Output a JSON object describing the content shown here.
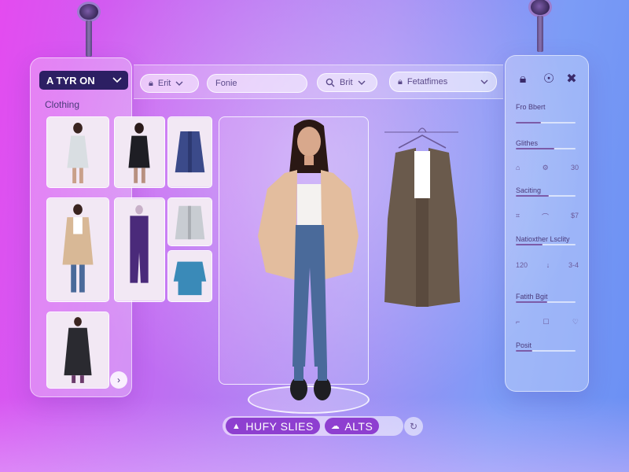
{
  "brand": {
    "label": "A TYR ON"
  },
  "sidebar": {
    "section_title": "Clothing"
  },
  "toolbar": {
    "edit_label": "Erit",
    "name_value": "Fonie",
    "search_label": "Brit",
    "features_label": "Fetatfimes"
  },
  "settings": {
    "fit_label": "Fro Bbert",
    "fit_level": 0.42,
    "size_label": "Glithes",
    "size_level": 0.65,
    "size_row": [
      "30"
    ],
    "scaling_label": "Saciting",
    "scaling_level": 0.55,
    "scaling_row": [
      "$7"
    ],
    "measure_label": "Natioxther Lsclity",
    "measure_level": 0.45,
    "measure_row": [
      "120",
      "3-4"
    ],
    "fabric_label": "Fatith Bgit",
    "fabric_level": 0.52,
    "posit_label": "Posit",
    "posit_level": 0.28
  },
  "footer": {
    "primary_label": "HUFY SLIES",
    "secondary_label": "ALTS"
  },
  "colors": {
    "accent": "#8e3fd0",
    "brand_bg": "#2c1f63",
    "coat": "#e3bd9e",
    "jeans": "#4a6a9a"
  },
  "icons": [
    "lock-icon",
    "bottle-icon",
    "fit-toggle-icon",
    "search-icon",
    "chevron-down-icon",
    "next-arrow-icon",
    "hanger-icon"
  ]
}
